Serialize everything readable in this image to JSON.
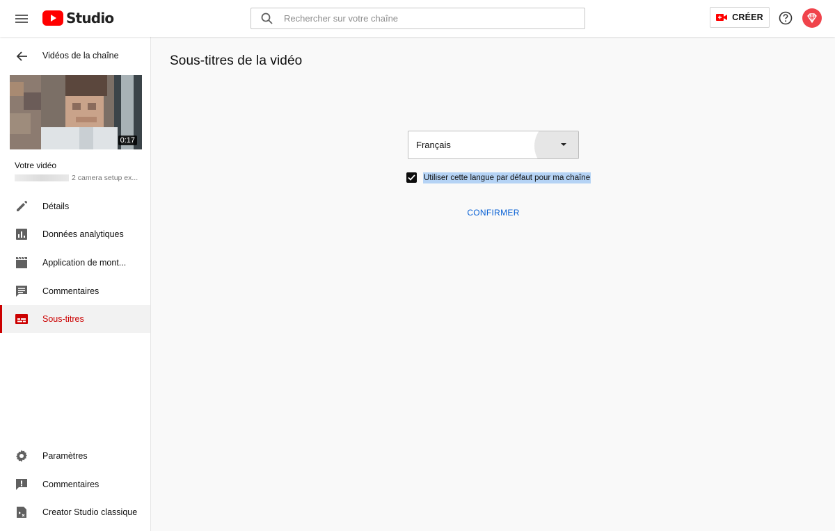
{
  "header": {
    "logo_text": "Studio",
    "search_placeholder": "Rechercher sur votre chaîne",
    "create_label": "CRÉER"
  },
  "sidebar": {
    "back_label": "Vidéos de la chaîne",
    "video": {
      "duration": "0:17",
      "title": "Votre vidéo",
      "subtitle": "2 camera setup ex..."
    },
    "items": [
      {
        "label": "Détails",
        "icon": "pencil-icon"
      },
      {
        "label": "Données analytiques",
        "icon": "analytics-icon"
      },
      {
        "label": "Application de mont...",
        "icon": "clapperboard-icon"
      },
      {
        "label": "Commentaires",
        "icon": "comment-icon"
      },
      {
        "label": "Sous-titres",
        "icon": "subtitles-icon",
        "active": true
      }
    ],
    "bottom_items": [
      {
        "label": "Paramètres",
        "icon": "gear-icon"
      },
      {
        "label": "Commentaires",
        "icon": "feedback-icon"
      },
      {
        "label": "Creator Studio classique",
        "icon": "classic-studio-icon"
      }
    ]
  },
  "main": {
    "title": "Sous-titres de la vidéo",
    "language_value": "Français",
    "default_checkbox_checked": true,
    "default_checkbox_label": "Utiliser cette langue par défaut pour ma chaîne",
    "confirm_label": "CONFIRMER"
  },
  "colors": {
    "accent_red": "#cc0000",
    "link_blue": "#065fd4",
    "selection_highlight": "#b5d3f5"
  }
}
